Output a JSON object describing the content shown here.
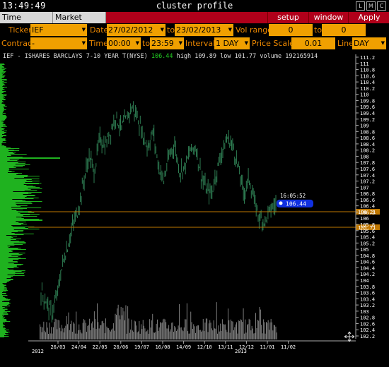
{
  "window": {
    "clock": "13:49:49",
    "title": "cluster profile",
    "buttons": [
      "L",
      "M",
      "C"
    ]
  },
  "tabs": [
    "Time Interval",
    "Market Watch"
  ],
  "actions": {
    "setup": "setup",
    "window": "window",
    "apply": "Apply"
  },
  "controls": {
    "ticker_label": "Ticker",
    "ticker_value": "IEF",
    "date_label": "Date",
    "date_from": "27/02/2012",
    "date_to_label": "to",
    "date_to": "23/02/2013",
    "vol_range_label": "Vol range",
    "vol_from": "0",
    "vol_to_label": "to",
    "vol_to": "0",
    "contract_label": "Contract",
    "contract_value": "-",
    "time_label": "Time",
    "time_from": "00:00",
    "time_to_label": "to",
    "time_to": "23:59",
    "interval_label": "Interval",
    "interval_value": "1 DAY",
    "price_scale_label": "Price Scale",
    "price_scale_value": "0.01",
    "line_label": "Line",
    "line_value": "DAY"
  },
  "info": {
    "name": "IEF - ISHARES BARCLAYS 7-10 YEAR T(NYSE)",
    "last": "106.44",
    "high": "high 109.89",
    "low": "low 101.77",
    "volume": "volume 192165914"
  },
  "chart_data": {
    "type": "candlestick",
    "y_ticks": [
      "111.2",
      "111",
      "110.8",
      "110.6",
      "110.4",
      "110.2",
      "110",
      "109.8",
      "109.6",
      "109.4",
      "109.2",
      "109",
      "108.8",
      "108.6",
      "108.4",
      "108.2",
      "108",
      "107.8",
      "107.6",
      "107.4",
      "107.2",
      "107",
      "106.8",
      "106.6",
      "106.4",
      "106.2",
      "106",
      "105.8",
      "105.6",
      "105.4",
      "105.2",
      "105",
      "104.8",
      "104.6",
      "104.4",
      "104.2",
      "104",
      "103.8",
      "103.6",
      "103.4",
      "103.2",
      "103",
      "102.8",
      "102.6",
      "102.4",
      "102.2"
    ],
    "ylim": [
      102.2,
      111.2
    ],
    "x_ticks": [
      "26/03",
      "24/04",
      "22/05",
      "20/06",
      "19/07",
      "16/08",
      "14/09",
      "12/10",
      "13/11",
      "12/12",
      "11/01",
      "11/02"
    ],
    "year_labels": [
      "2012",
      "2013"
    ],
    "last_time": "16:05:52",
    "last_price": "106.44",
    "line_labels": [
      "106.21",
      "105.71"
    ],
    "line_values": [
      106.21,
      105.71
    ],
    "high": 109.89,
    "low": 101.77,
    "close_path": [
      103.6,
      103.3,
      102.9,
      103.5,
      104.5,
      105.1,
      105.8,
      106.3,
      107.2,
      108.0,
      107.5,
      108.6,
      108.3,
      108.8,
      109.3,
      108.9,
      109.2,
      109.6,
      109.3,
      108.7,
      108.3,
      108.8,
      107.7,
      107.2,
      108.0,
      108.4,
      107.5,
      107.7,
      108.2,
      108.3,
      107.4,
      106.9,
      106.8,
      107.6,
      108.2,
      108.6,
      108.3,
      107.6,
      106.8,
      107.3,
      106.5,
      106.0,
      105.9,
      106.3,
      106.44
    ]
  }
}
